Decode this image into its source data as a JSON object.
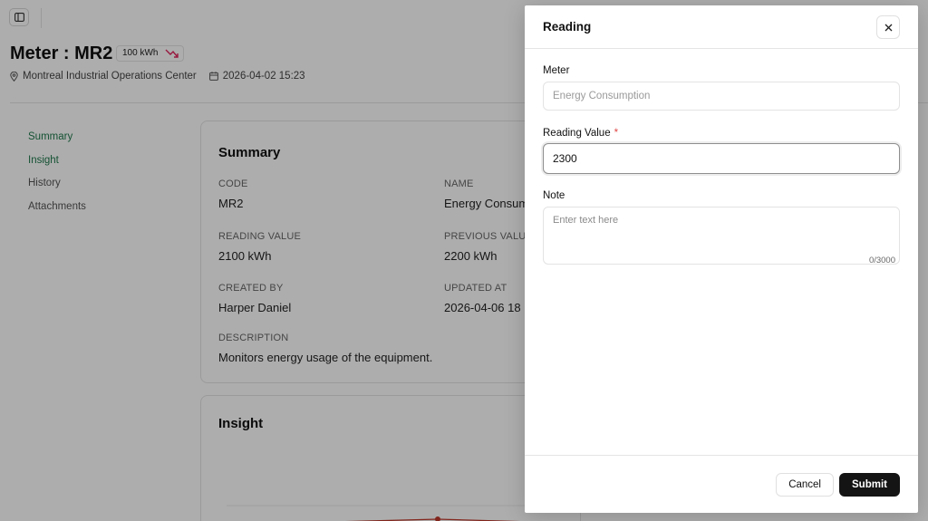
{
  "page": {
    "title": "Meter : MR2",
    "badge_value": "100 kWh",
    "location": "Montreal Industrial Operations Center",
    "date": "2026-04-02 15:23",
    "nav": [
      {
        "label": "Summary"
      },
      {
        "label": "Insight"
      },
      {
        "label": "History"
      },
      {
        "label": "Attachments"
      }
    ],
    "summary": {
      "title": "Summary",
      "code_label": "CODE",
      "code_value": "MR2",
      "name_label": "NAME",
      "name_value": "Energy Consump",
      "reading_value_label": "READING VALUE",
      "reading_value": "2100 kWh",
      "previous_value_label": "PREVIOUS VALUE",
      "previous_value": "2200 kWh",
      "created_by_label": "CREATED BY",
      "created_by": "Harper Daniel",
      "updated_at_label": "UPDATED AT",
      "updated_at": "2026-04-06 18",
      "description_label": "DESCRIPTION",
      "description": "Monitors energy usage of the equipment."
    },
    "insight": {
      "title": "Insight"
    }
  },
  "dialog": {
    "title": "Reading",
    "meter_label": "Meter",
    "meter_placeholder": "Energy Consumption",
    "reading_value_label": "Reading Value",
    "required_mark": "*",
    "reading_value": "2300",
    "note_label": "Note",
    "note_placeholder": "Enter text here",
    "note_counter": "0/3000",
    "cancel_label": "Cancel",
    "submit_label": "Submit"
  },
  "colors": {
    "active_nav": "#1f7a4d",
    "trend_down": "#e0245e",
    "chart_line": "#c0392b",
    "submit_bg": "#141414",
    "required": "#e04848"
  }
}
